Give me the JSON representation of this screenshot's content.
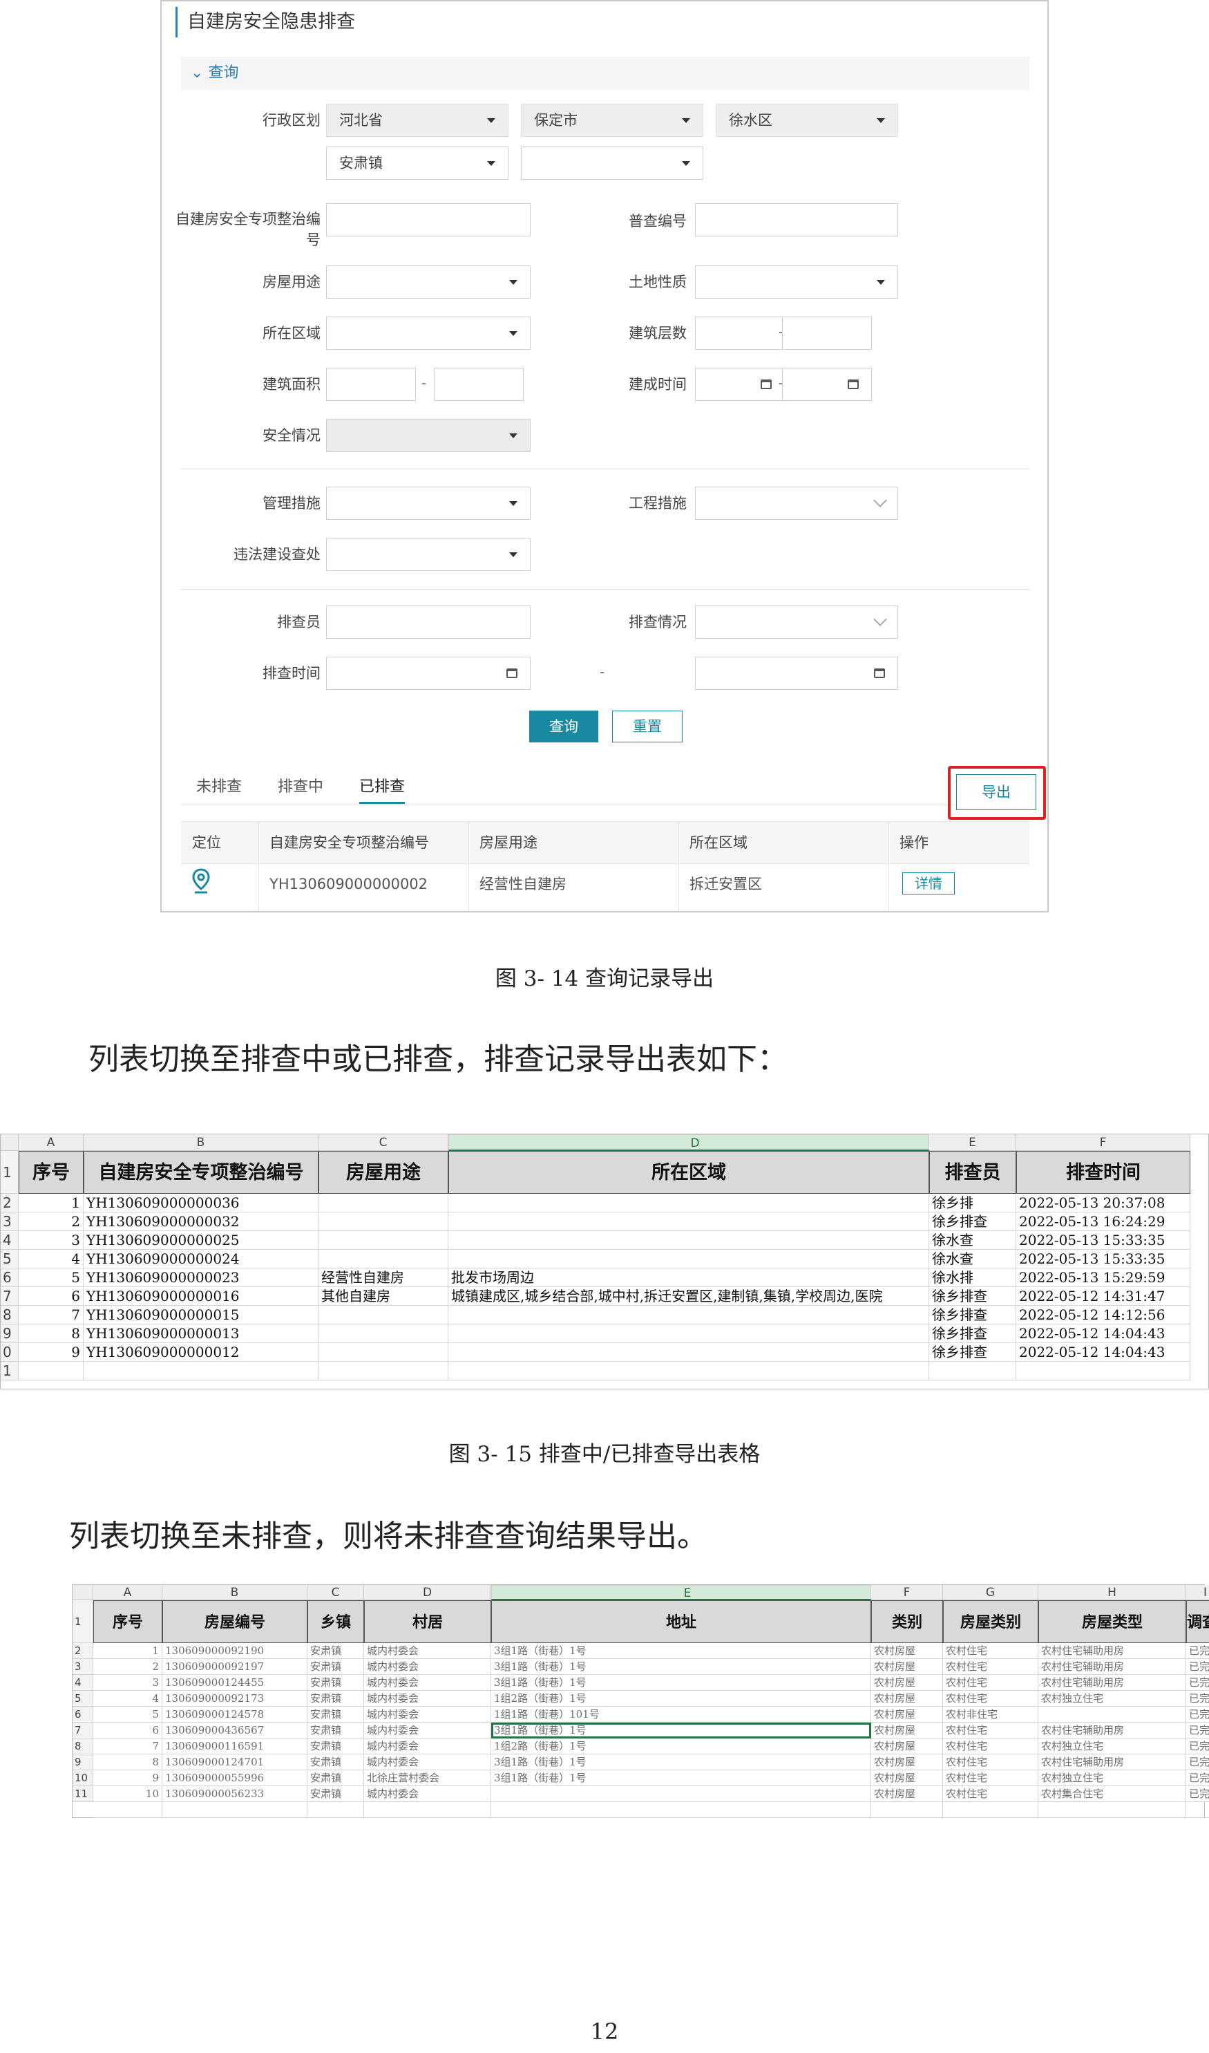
{
  "fig1": {
    "panel_title": "自建房安全隐患排查",
    "query_label": "查询",
    "labels": {
      "admin_region": "行政区划",
      "special_no": "自建房安全专项整治编号",
      "survey_no": "普查编号",
      "house_use": "房屋用途",
      "land_nature": "土地性质",
      "area_loc": "所在区域",
      "floors": "建筑层数",
      "build_area": "建筑面积",
      "build_time": "建成时间",
      "safety": "安全情况",
      "mgmt": "管理措施",
      "eng": "工程措施",
      "illegal": "违法建设查处",
      "inspector": "排查员",
      "inspect_status": "排查情况",
      "inspect_time": "排查时间"
    },
    "region": {
      "province": "河北省",
      "city": "保定市",
      "district": "徐水区",
      "town": "安肃镇"
    },
    "buttons": {
      "query": "查询",
      "reset": "重置",
      "export": "导出",
      "detail": "详情"
    },
    "tabs": [
      "未排查",
      "排查中",
      "已排查"
    ],
    "table": {
      "headers": [
        "定位",
        "自建房安全专项整治编号",
        "房屋用途",
        "所在区域",
        "操作"
      ],
      "row": {
        "code": "YH130609000000002",
        "use": "经营性自建房",
        "area": "拆迁安置区"
      }
    }
  },
  "caption1": "图 3- 14 查询记录导出",
  "para1": "列表切换至排查中或已排查，排查记录导出表如下：",
  "sheet1": {
    "columns": [
      "A",
      "B",
      "C",
      "D",
      "E",
      "F"
    ],
    "headers": [
      "序号",
      "自建房安全专项整治编号",
      "房屋用途",
      "所在区域",
      "排查员",
      "排查时间"
    ],
    "row_numbers": [
      "1",
      "2",
      "3",
      "4",
      "5",
      "6",
      "7",
      "8",
      "9",
      "0",
      "1"
    ],
    "rows": [
      [
        "1",
        "YH130609000000036",
        "",
        "",
        "徐乡排",
        "2022-05-13 20:37:08"
      ],
      [
        "2",
        "YH130609000000032",
        "",
        "",
        "徐乡排查",
        "2022-05-13 16:24:29"
      ],
      [
        "3",
        "YH130609000000025",
        "",
        "",
        "徐水查",
        "2022-05-13 15:33:35"
      ],
      [
        "4",
        "YH130609000000024",
        "",
        "",
        "徐水查",
        "2022-05-13 15:33:35"
      ],
      [
        "5",
        "YH130609000000023",
        "经营性自建房",
        "批发市场周边",
        "徐水排",
        "2022-05-13 15:29:59"
      ],
      [
        "6",
        "YH130609000000016",
        "其他自建房",
        "城镇建成区,城乡结合部,城中村,拆迁安置区,建制镇,集镇,学校周边,医院",
        "徐乡排查",
        "2022-05-12 14:31:47"
      ],
      [
        "7",
        "YH130609000000015",
        "",
        "",
        "徐乡排查",
        "2022-05-12 14:12:56"
      ],
      [
        "8",
        "YH130609000000013",
        "",
        "",
        "徐乡排查",
        "2022-05-12 14:04:43"
      ],
      [
        "9",
        "YH130609000000012",
        "",
        "",
        "徐乡排查",
        "2022-05-12 14:04:43"
      ]
    ]
  },
  "caption2": "图 3- 15 排查中/已排查导出表格",
  "para2": "列表切换至未排查，则将未排查查询结果导出。",
  "sheet2": {
    "columns": [
      "A",
      "B",
      "C",
      "D",
      "E",
      "F",
      "G",
      "H",
      "I"
    ],
    "headers": [
      "序号",
      "房屋编号",
      "乡镇",
      "村居",
      "地址",
      "类别",
      "房屋类别",
      "房屋类型",
      "调查状态"
    ],
    "row_numbers": [
      "1",
      "2",
      "3",
      "4",
      "5",
      "6",
      "7",
      "8",
      "9",
      "10",
      "11"
    ],
    "rows": [
      [
        "1",
        "130609000092190",
        "安肃镇",
        "城内村委会",
        "3组1路（街巷）1号",
        "农村房屋",
        "农村住宅",
        "农村住宅辅助用房",
        "已完成"
      ],
      [
        "2",
        "130609000092197",
        "安肃镇",
        "城内村委会",
        "3组1路（街巷）1号",
        "农村房屋",
        "农村住宅",
        "农村住宅辅助用房",
        "已完成"
      ],
      [
        "3",
        "130609000124455",
        "安肃镇",
        "城内村委会",
        "3组1路（街巷）1号",
        "农村房屋",
        "农村住宅",
        "农村住宅辅助用房",
        "已完成"
      ],
      [
        "4",
        "130609000092173",
        "安肃镇",
        "城内村委会",
        "1组2路（街巷）1号",
        "农村房屋",
        "农村住宅",
        "农村独立住宅",
        "已完成"
      ],
      [
        "5",
        "130609000124578",
        "安肃镇",
        "城内村委会",
        "1组1路（街巷）101号",
        "农村房屋",
        "农村非住宅",
        "",
        "已完成"
      ],
      [
        "6",
        "130609000436567",
        "安肃镇",
        "城内村委会",
        "3组1路（街巷）1号",
        "农村房屋",
        "农村住宅",
        "农村住宅辅助用房",
        "已完成"
      ],
      [
        "7",
        "130609000116591",
        "安肃镇",
        "城内村委会",
        "1组2路（街巷）1号",
        "农村房屋",
        "农村住宅",
        "农村独立住宅",
        "已完成"
      ],
      [
        "8",
        "130609000124701",
        "安肃镇",
        "城内村委会",
        "3组1路（街巷）1号",
        "农村房屋",
        "农村住宅",
        "农村住宅辅助用房",
        "已完成"
      ],
      [
        "9",
        "130609000055996",
        "安肃镇",
        "北徐庄营村委会",
        "3组1路（街巷）1号",
        "农村房屋",
        "农村住宅",
        "农村独立住宅",
        "已完成"
      ],
      [
        "10",
        "130609000056233",
        "安肃镇",
        "城内村委会",
        "",
        "农村房屋",
        "农村住宅",
        "农村集合住宅",
        "已完成"
      ]
    ]
  },
  "page_number": "12"
}
